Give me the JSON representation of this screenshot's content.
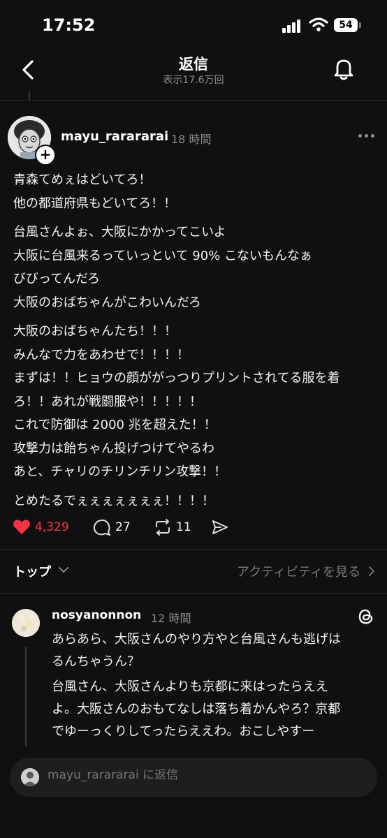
{
  "status": {
    "time": "17:52",
    "battery": "54"
  },
  "nav": {
    "title": "返信",
    "views": "表示17.6万回"
  },
  "post": {
    "author": "mayu_rarararai",
    "time": "18 時間",
    "paragraphs": [
      [
        "青森てめぇはどいてろ！",
        "他の都道府県もどいてろ！！"
      ],
      [
        "台風さんよぉ、大阪にかかってこいよ",
        "大阪に台風来るっていっといて 90% こないもんなぁ",
        "びびってんだろ",
        "大阪のおばちゃんがこわいんだろ"
      ],
      [
        "大阪のおばちゃんたち！！！",
        "みんなで力をあわせで！！！！",
        "まずは！！ヒョウの顔ががっつりプリントされてる服を着",
        "ろ！！あれが戦闘服や！！！！！",
        "これで防御は 2000 兆を超えた！！",
        "攻撃力は飴ちゃん投げつけてやるわ",
        "あと、チャリのチリンチリン攻撃！！"
      ],
      [
        "とめたるでぇぇぇぇぇぇぇ！！！！"
      ]
    ],
    "likes": "4,329",
    "comments": "27",
    "reposts": "11"
  },
  "sort": {
    "label": "トップ",
    "activity": "アクティビティを見る"
  },
  "reply": {
    "author": "nosyanonnon",
    "time": "12 時間",
    "paragraphs": [
      [
        "あらあら、大阪さんのやり方やと台風さんも逃げは",
        "るんちゃうん？"
      ],
      [
        "台風さん、大阪さんよりも京都に来はったらええ",
        "よ。大阪さんのおもてなしは落ち着かんやろ？京都",
        "でゆーっくりしてったらええわ。おこしやすー"
      ]
    ]
  },
  "composer": {
    "placeholder": "mayu_rarararai に返信"
  },
  "colors": {
    "background": "#101010",
    "like": "#ff3040",
    "muted": "#8e8e8e"
  },
  "icons": [
    "back-arrow-icon",
    "bell-icon",
    "heart-icon",
    "comment-icon",
    "repost-icon",
    "share-icon",
    "threads-icon",
    "chevron-down-icon",
    "chevron-right-icon"
  ]
}
